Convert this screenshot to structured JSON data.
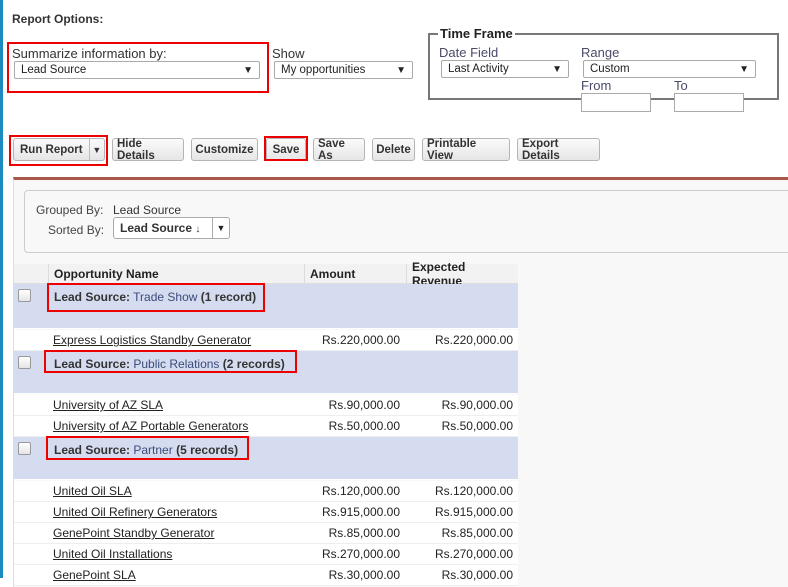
{
  "report_options": {
    "title": "Report Options:",
    "summarize": {
      "label": "Summarize information by:",
      "value": "Lead Source"
    },
    "show": {
      "label": "Show",
      "value": "My opportunities"
    },
    "time_frame": {
      "legend": "Time Frame",
      "date_field_label": "Date Field",
      "date_field_value": "Last Activity",
      "range_label": "Range",
      "range_value": "Custom",
      "from_label": "From",
      "from_value": "",
      "to_label": "To",
      "to_value": ""
    }
  },
  "toolbar": {
    "run_report": "Run Report",
    "hide_details": "Hide Details",
    "customize": "Customize",
    "save": "Save",
    "save_as": "Save As",
    "delete": "Delete",
    "printable_view": "Printable View",
    "export_details": "Export Details"
  },
  "filter": {
    "grouped_by_label": "Grouped By:",
    "grouped_by_value": "Lead Source",
    "sorted_by_label": "Sorted By:",
    "sorted_by_value": "Lead Source",
    "sort_icon": "↓"
  },
  "table": {
    "columns": [
      "Opportunity Name",
      "Amount",
      "Expected Revenue"
    ],
    "groups": [
      {
        "label": "Lead Source:",
        "value": "Trade Show",
        "count": "(1 record)",
        "rows": [
          {
            "name": "Express Logistics Standby Generator",
            "amount": "Rs.220,000.00",
            "expected": "Rs.220,000.00"
          }
        ]
      },
      {
        "label": "Lead Source:",
        "value": "Public Relations",
        "count": "(2 records)",
        "rows": [
          {
            "name": "University of AZ SLA",
            "amount": "Rs.90,000.00",
            "expected": "Rs.90,000.00"
          },
          {
            "name": "University of AZ Portable Generators",
            "amount": "Rs.50,000.00",
            "expected": "Rs.50,000.00"
          }
        ]
      },
      {
        "label": "Lead Source:",
        "value": "Partner",
        "count": "(5 records)",
        "rows": [
          {
            "name": "United Oil SLA",
            "amount": "Rs.120,000.00",
            "expected": "Rs.120,000.00"
          },
          {
            "name": "United Oil Refinery Generators",
            "amount": "Rs.915,000.00",
            "expected": "Rs.915,000.00"
          },
          {
            "name": "GenePoint Standby Generator",
            "amount": "Rs.85,000.00",
            "expected": "Rs.85,000.00"
          },
          {
            "name": "United Oil Installations",
            "amount": "Rs.270,000.00",
            "expected": "Rs.270,000.00"
          },
          {
            "name": "GenePoint SLA",
            "amount": "Rs.30,000.00",
            "expected": "Rs.30,000.00"
          }
        ]
      }
    ]
  },
  "colors": {
    "highlight": "#e00000",
    "group_row": "#d6dcef",
    "panel_border": "#a8574a",
    "left_bar": "#1b8bbf"
  }
}
